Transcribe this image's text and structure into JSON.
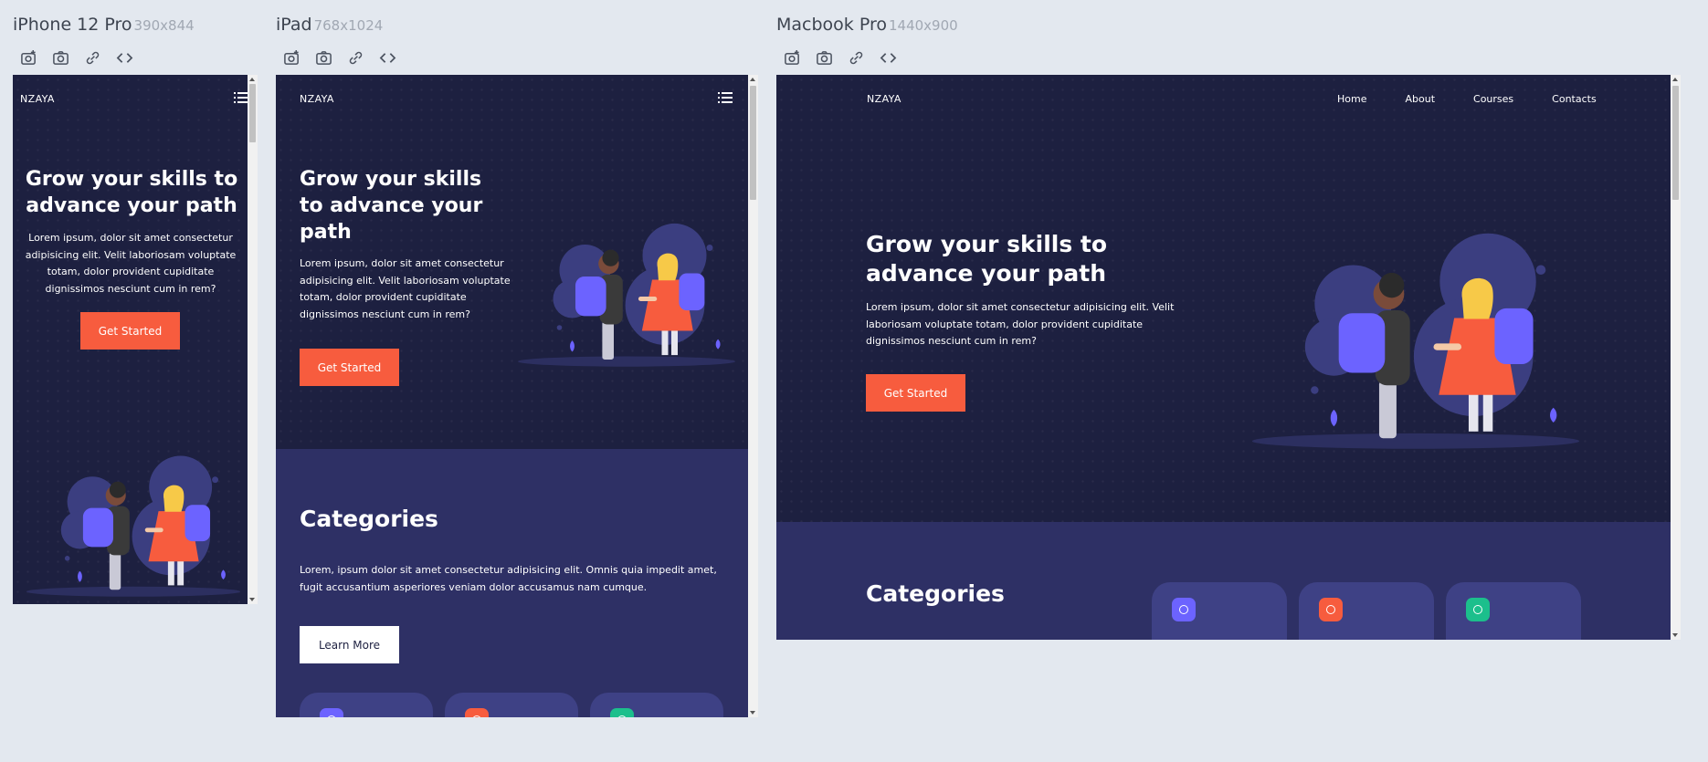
{
  "devices": {
    "iphone": {
      "name": "iPhone 12 Pro",
      "size": "390x844"
    },
    "ipad": {
      "name": "iPad",
      "size": "768x1024"
    },
    "macbook": {
      "name": "Macbook Pro",
      "size": "1440x900"
    }
  },
  "toolbar_icons": [
    "screenshot-full-icon",
    "camera-icon",
    "link-icon",
    "code-icon"
  ],
  "site": {
    "logo": "NZAYA",
    "nav": [
      "Home",
      "About",
      "Courses",
      "Contacts"
    ],
    "hero": {
      "title": "Grow your skills to advance your path",
      "text": "Lorem ipsum, dolor sit amet consectetur adipisicing elit. Velit laboriosam voluptate totam, dolor provident cupiditate dignissimos nesciunt cum in rem?",
      "cta": "Get Started"
    },
    "categories": {
      "title": "Categories",
      "text": "Lorem, ipsum dolor sit amet consectetur adipisicing elit. Omnis quia impedit amet, fugit accusantium asperiores veniam dolor accusamus nam cumque.",
      "cta": "Learn More"
    }
  },
  "colors": {
    "hero_bg": "#1d2040",
    "section_bg": "#2e3065",
    "card_bg": "#3e4185",
    "accent": "#f75c3e",
    "icon_purple": "#6c63ff",
    "icon_orange": "#f75c3e",
    "icon_green": "#1cbf8c"
  }
}
